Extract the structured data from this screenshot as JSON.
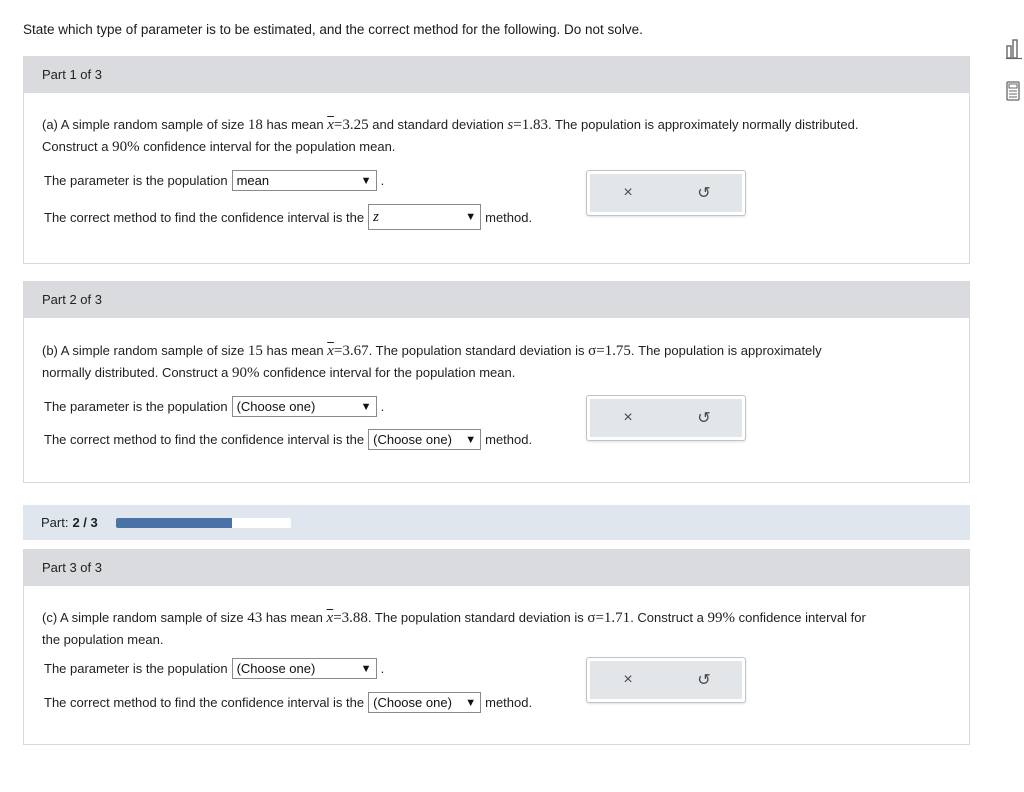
{
  "instructions": "State which type of parameter is to be estimated, and the correct method for the following. Do not solve.",
  "side_icons": [
    "bar-chart-icon",
    "calculator-icon"
  ],
  "parts": [
    {
      "header": "Part 1 of 3",
      "problem": {
        "prefix": "(a) A simple random sample of size ",
        "n": "18",
        "mid1": " has mean ",
        "xbar_symbol": "x",
        "eq1": "=3.25",
        "mid2": " and standard deviation ",
        "s_symbol": "s",
        "eq2": "=1.83",
        "rest": ". The population is approximately normally distributed.",
        "line2_prefix": "Construct a ",
        "conf": "90%",
        "line2_suffix": " confidence interval for the population mean."
      },
      "param_label": "The parameter is the population",
      "param_value": "mean",
      "method_label": "The correct method to find the confidence interval is the",
      "method_value": "z",
      "method_suffix": "method."
    },
    {
      "header": "Part 2 of 3",
      "problem": {
        "prefix": "(b) A simple random sample of size ",
        "n": "15",
        "mid1": " has mean ",
        "xbar_symbol": "x",
        "eq1": "=3.67",
        "mid2": ". The population standard deviation is ",
        "sigma": "σ=1.75",
        "rest": ". The population is approximately",
        "line2_prefix": "normally distributed. Construct a ",
        "conf": "90%",
        "line2_suffix": " confidence interval for the population mean."
      },
      "param_label": "The parameter is the population",
      "param_value": "(Choose one)",
      "method_label": "The correct method to find the confidence interval is the",
      "method_value": "(Choose one)",
      "method_suffix": "method."
    },
    {
      "header": "Part 3 of 3",
      "problem": {
        "prefix": "(c) A simple random sample of size ",
        "n": "43",
        "mid1": " has mean ",
        "xbar_symbol": "x",
        "eq1": "=3.88",
        "mid2": ". The population standard deviation is ",
        "sigma": "σ=1.71",
        "rest": ". Construct a ",
        "conf": "99%",
        "rest2": " confidence interval for",
        "line2": "the population mean."
      },
      "param_label": "The parameter is the population",
      "param_value": "(Choose one)",
      "method_label": "The correct method to find the confidence interval is the",
      "method_value": "(Choose one)",
      "method_suffix": "method."
    }
  ],
  "progress": {
    "label": "Part:",
    "value": "2 / 3",
    "fraction": 0.667,
    "fill_color": "#4a72a6"
  },
  "actions": {
    "clear_icon": "×",
    "undo_icon": "↺"
  }
}
